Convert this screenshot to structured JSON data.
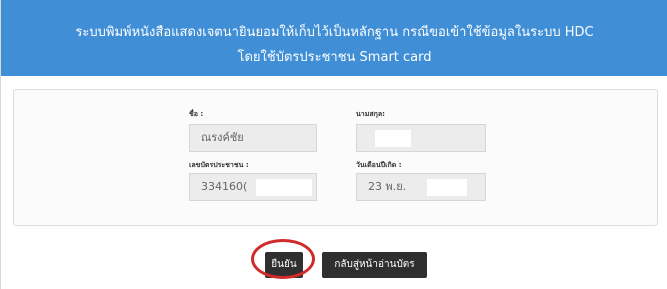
{
  "header": {
    "title_line1": "ระบบพิมพ์หนังสือแสดงเจตนายินยอมให้เก็บไว้เป็นหลักฐาน กรณีขอเข้าใช้ข้อมูลในระบบ HDC",
    "title_line2": "โดยใช้บัตรประชาชน Smart card",
    "color": "#3f8ed6"
  },
  "form": {
    "first_name_label": "ชื่อ :",
    "first_name_value": "ณรงค์ชัย",
    "last_name_label": "นามสกุล:",
    "last_name_value": "",
    "id_label": "เลขบัตรประชาชน :",
    "id_value": "334160(",
    "birthdate_label": "วันเดือนปีเกิด :",
    "birthdate_value": "23 พ.ย."
  },
  "actions": {
    "confirm_label": "ยืนยัน",
    "back_label": "กลับสู่หน้าอ่านบัตร",
    "highlight_color": "#d12a2a"
  }
}
